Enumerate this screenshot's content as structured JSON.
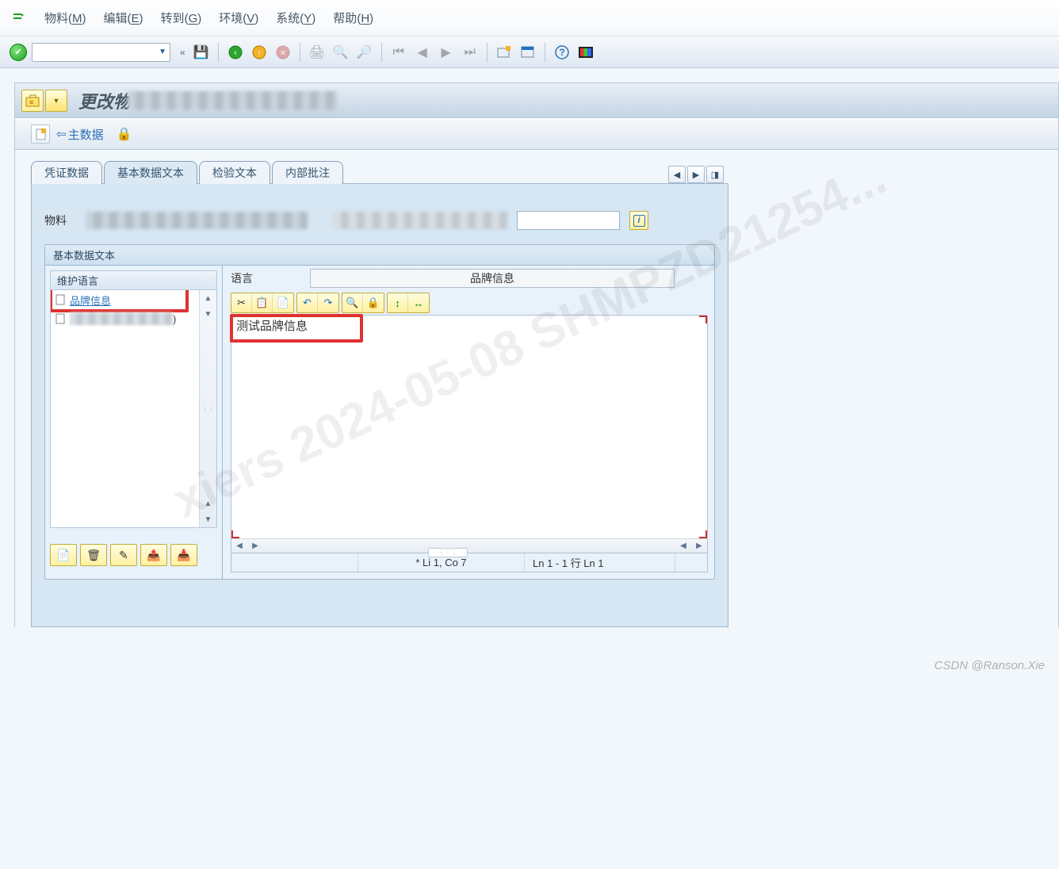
{
  "watermarks": {
    "diag": "xiers 2024-05-08 SHMPZD21254...",
    "csdn": "CSDN @Ranson.Xie"
  },
  "menu": {
    "items": [
      {
        "label": "物料",
        "accel": "M"
      },
      {
        "label": "编辑",
        "accel": "E"
      },
      {
        "label": "转到",
        "accel": "G"
      },
      {
        "label": "环境",
        "accel": "V"
      },
      {
        "label": "系统",
        "accel": "Y"
      },
      {
        "label": "帮助",
        "accel": "H"
      }
    ]
  },
  "toolbar_icons": {
    "save": "💾",
    "back": "⟲",
    "exit": "✖",
    "print": "🖨",
    "find": "🔍",
    "findnext": "🔎",
    "first": "⏮",
    "prev": "◀",
    "next": "▶",
    "last": "⏭",
    "newwin": "🪟",
    "layout": "▦",
    "help": "❔",
    "monitor": "▢"
  },
  "window_title": "更改物",
  "apptb": {
    "back_label": "主数据"
  },
  "tabs": {
    "items": [
      {
        "label": "凭证数据",
        "active": false
      },
      {
        "label": "基本数据文本",
        "active": true
      },
      {
        "label": "检验文本",
        "active": false
      },
      {
        "label": "内部批注",
        "active": false
      }
    ]
  },
  "material": {
    "label": "物料"
  },
  "groupbox": {
    "title": "基本数据文本"
  },
  "maintain_lang": {
    "header": "维护语言",
    "rows": [
      {
        "label": "品牌信息",
        "link": true,
        "highlight": true
      },
      {
        "blur": true
      }
    ],
    "btns_icons": [
      "📄",
      "🗑",
      "✎",
      "📤",
      "📥"
    ]
  },
  "editor": {
    "lang_label": "语言",
    "lang_value": "品牌信息",
    "toolbar": [
      [
        "✂",
        "📋",
        "📄"
      ],
      [
        "↶",
        "↷"
      ],
      [
        "🔍",
        "🔒"
      ],
      [
        "↕",
        "↔"
      ]
    ],
    "text": "测试品牌信息",
    "status": {
      "modified": "*",
      "pos": "Li 1, Co 7",
      "lines": "Ln 1 - 1 行 Ln 1"
    }
  }
}
